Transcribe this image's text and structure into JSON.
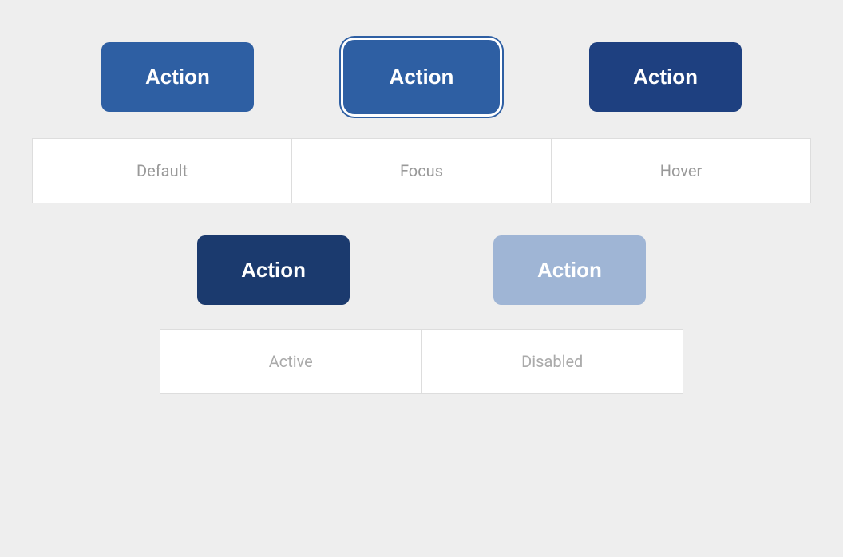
{
  "background_color": "#eeeeee",
  "top_row": {
    "btn_default_label": "Action",
    "btn_focus_label": "Action",
    "btn_hover_label": "Action"
  },
  "labels_row": {
    "label_default": "Default",
    "label_focus": "Focus",
    "label_hover": "Hover"
  },
  "bottom_row": {
    "btn_active_label": "Action",
    "btn_disabled_label": "Action"
  },
  "bottom_labels_row": {
    "label_active": "Active",
    "label_disabled": "Disabled"
  }
}
